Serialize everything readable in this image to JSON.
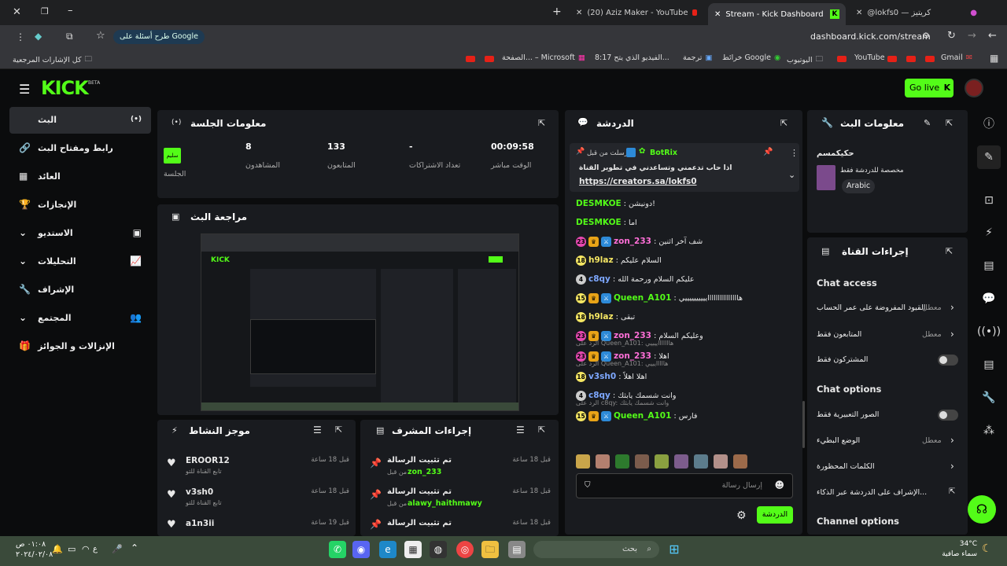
{
  "browser": {
    "tabs": [
      {
        "title": "(20) Aziz Maker - YouTube"
      },
      {
        "title": "Stream - Kick Dashboard"
      },
      {
        "title": "@lokfs0 — كريتيز"
      }
    ],
    "url": "dashboard.kick.com/stream",
    "google_chip": "طرح أسئلة على Google",
    "bookmarks": [
      "Gmail",
      "YouTube",
      "اليوتيوب",
      "خرائط Google",
      "ترجمة",
      "8:17 الفيديو الذي يتح...",
      "الصفحة... – Microsoft"
    ],
    "all_bookmarks": "كل الإشارات المرجعية"
  },
  "header": {
    "logo": "KICK",
    "beta": "BETA",
    "go_live": "Go live"
  },
  "sidebar": {
    "items": [
      {
        "label": "البث",
        "icon": "(•)"
      },
      {
        "label": "رابط ومفتاح البث",
        "icon": "🔗"
      },
      {
        "label": "العائد",
        "icon": "▦"
      },
      {
        "label": "الإنجازات",
        "icon": "🏆"
      },
      {
        "label": "الاستديو",
        "icon": "▣"
      },
      {
        "label": "التحليلات",
        "icon": "📈"
      },
      {
        "label": "الإشراف",
        "icon": "🔧"
      },
      {
        "label": "المجتمع",
        "icon": "👥"
      },
      {
        "label": "الإنزالات و الجوائز",
        "icon": "🎁"
      }
    ]
  },
  "session": {
    "title": "معلومات الجلسة",
    "stats": [
      {
        "value": "00:09:58",
        "label": "الوقت مباشر"
      },
      {
        "value": "-",
        "label": "تعداد الاشتراكات"
      },
      {
        "value": "133",
        "label": "المتابعون"
      },
      {
        "value": "8",
        "label": "المشاهدون"
      }
    ],
    "badge": "سليم",
    "badge_label": "الجلسة"
  },
  "preview": {
    "title": "مراجعة البث"
  },
  "activity": {
    "title": "موجز النشاط",
    "items": [
      {
        "user": "EROOR12",
        "sub": "تابع القناة للتو",
        "time": "قبل 18 ساعة"
      },
      {
        "user": "v3sh0",
        "sub": "تابع القناة للتو",
        "time": "قبل 18 ساعة"
      },
      {
        "user": "a1n3ii",
        "sub": "",
        "time": "قبل 19 ساعة"
      }
    ]
  },
  "modactions": {
    "title": "إجراءات المشرف",
    "items": [
      {
        "action": "تم تثبيت الرسالة",
        "user": "zon_233",
        "by": "من قبل",
        "time": "قبل 18 ساعة"
      },
      {
        "action": "تم تثبيت الرسالة",
        "user": "alawy_haithmawy",
        "by": "من قبل",
        "time": "قبل 18 ساعة"
      },
      {
        "action": "تم تثبيت الرسالة",
        "user": "",
        "by": "",
        "time": "قبل 18 ساعة"
      }
    ]
  },
  "chat": {
    "title": "الدردشة",
    "pinned": {
      "by": "أرسلت من قبل",
      "bot": "BotRix",
      "text": "اذا حاب تدعمني وتساعدني في تطوير القناة",
      "link": "https://creators.sa/lokfs0"
    },
    "messages": [
      {
        "user": "DESMKOE",
        "color": "#53fc18",
        "text": "دونيشن!",
        "badges": []
      },
      {
        "user": "DESMKOE",
        "color": "#53fc18",
        "text": "اما",
        "badges": []
      },
      {
        "user": "zon_233",
        "color": "#ff6fd8",
        "text": "شف آخر اثنين",
        "badges": [
          "23",
          "crown",
          "sword"
        ]
      },
      {
        "user": "h9laz",
        "color": "#f5e663",
        "text": "السلام عليكم",
        "badges": [
          "18"
        ]
      },
      {
        "user": "c8qy",
        "color": "#7ea8ff",
        "text": "عليكم السلام ورحمة الله",
        "badges": [
          "4"
        ]
      },
      {
        "user": "Queen_A101",
        "color": "#53fc18",
        "text": "هاااااااااااااااييييييييييي",
        "badges": [
          "15",
          "crown",
          "sword"
        ]
      },
      {
        "user": "h9laz",
        "color": "#f5e663",
        "text": "تبقى",
        "badges": [
          "18"
        ]
      },
      {
        "user": "zon_233",
        "color": "#ff6fd8",
        "text": "وعليكم السلام",
        "badges": [
          "23",
          "crown",
          "sword"
        ]
      },
      {
        "user": "zon_233",
        "color": "#ff6fd8",
        "text": "اهلا",
        "badges": [
          "23",
          "crown",
          "sword"
        ],
        "reply": "الرد على Queen_A101: هاااااااييييي"
      },
      {
        "user": "v3sh0",
        "color": "#7ea8ff",
        "text": "اهلا اهلاً",
        "badges": [
          "18"
        ],
        "reply": "الرد على Queen_A101: هااااايييي"
      },
      {
        "user": "c8qy",
        "color": "#7ea8ff",
        "text": "وانت شسمك يابثك",
        "badges": [
          "4"
        ]
      },
      {
        "user": "Queen_A101",
        "color": "#53fc18",
        "text": "فارس",
        "badges": [
          "15",
          "crown",
          "sword"
        ],
        "reply": "الرد على c8qy: وانت شسمك يابثك"
      }
    ],
    "input_placeholder": "إرسال رسالة",
    "send_label": "الدردشة"
  },
  "stream_info": {
    "title": "معلومات البث",
    "stream_title": "حكيكمسم",
    "category": "مخصصة للدردشة فقط",
    "language": "Arabic"
  },
  "channel_actions": {
    "title": "إجراءات القناة",
    "chat_access": "Chat access",
    "access_items": [
      {
        "label": "القيود المفروضة على عمر الحساب",
        "state": "معطل",
        "kind": "chevron"
      },
      {
        "label": "المتابعون فقط",
        "state": "معطل",
        "kind": "chevron"
      },
      {
        "label": "المشتركون فقط",
        "state": "",
        "kind": "toggle"
      }
    ],
    "chat_options": "Chat options",
    "option_items": [
      {
        "label": "الصور التعبيرية فقط",
        "state": "",
        "kind": "toggle"
      },
      {
        "label": "الوضع البطيء",
        "state": "معطل",
        "kind": "chevron"
      },
      {
        "label": "الكلمات المحظورة",
        "state": "",
        "kind": "chevron"
      },
      {
        "label": "الإشراف على الدردشة عبر الذكاء...",
        "state": "",
        "kind": "link"
      }
    ],
    "channel_options": "Channel options"
  },
  "taskbar": {
    "search": "بحث",
    "temp": "34°C",
    "weather": "سماء صافية",
    "time": "٠١:٠٨ ص",
    "date": "٢٠٢٤/٠٢/٠٨",
    "lang": "ع"
  },
  "colors": {
    "accent": "#53fc18",
    "panel": "#191b1f",
    "bg": "#0b0c0d"
  }
}
